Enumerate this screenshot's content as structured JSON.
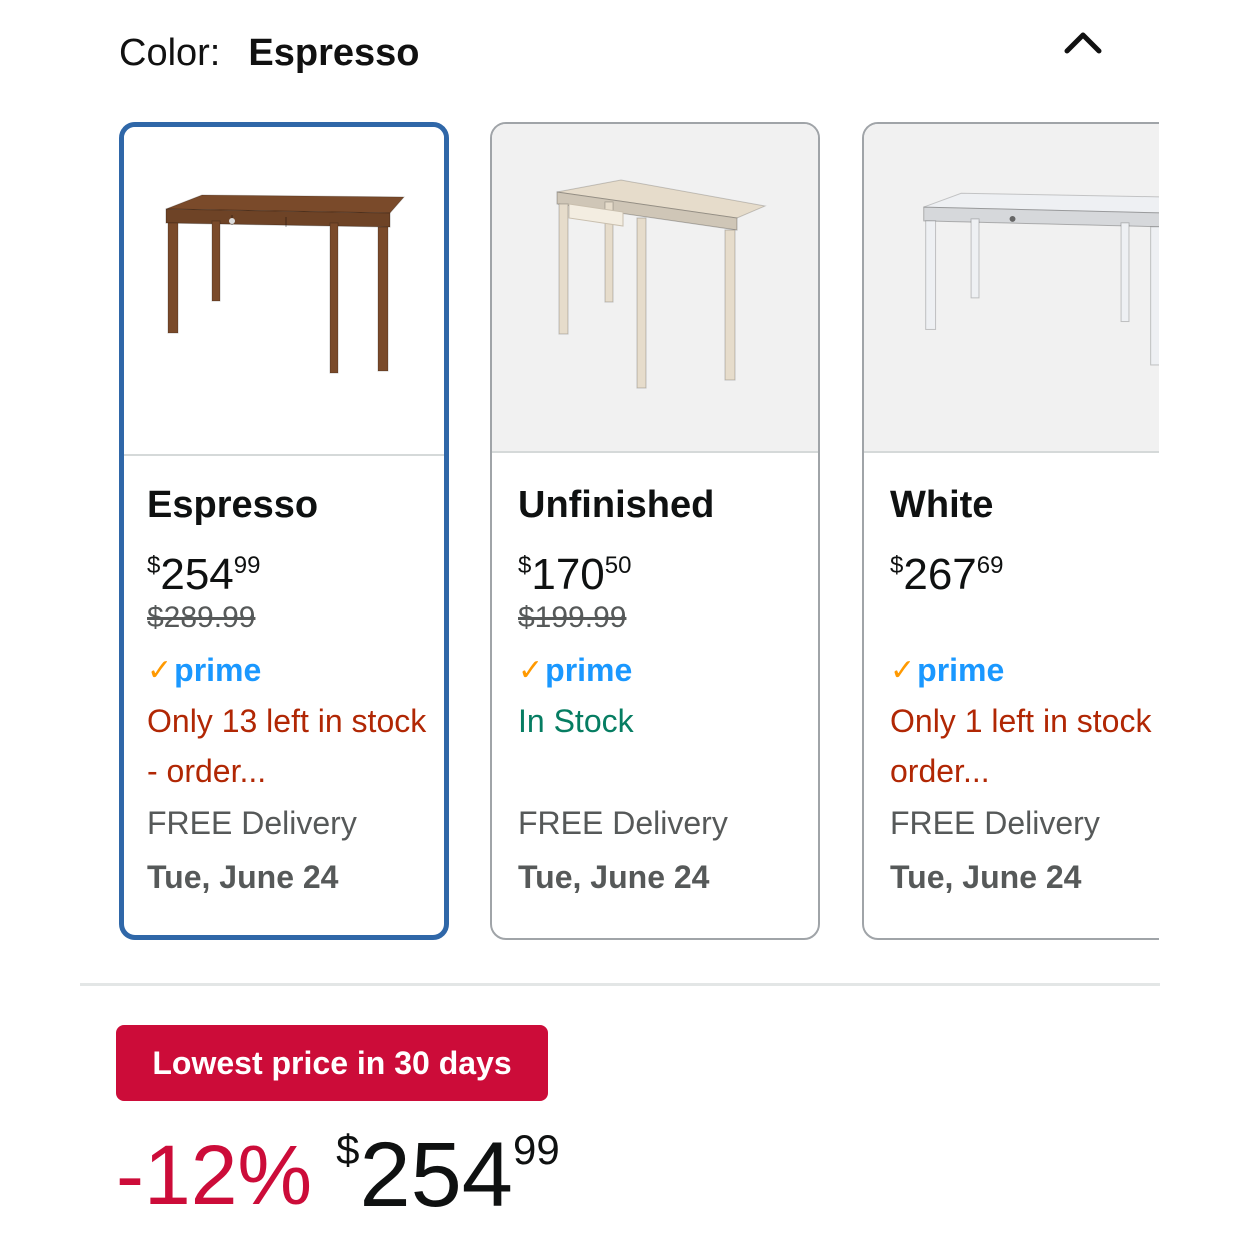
{
  "header": {
    "color_label": "Color:",
    "selected_color": "Espresso",
    "collapse_icon": "chevron-up-icon"
  },
  "variants": [
    {
      "name": "Espresso",
      "price_symbol": "$",
      "price_whole": "254",
      "price_fraction": "99",
      "list_price": "$289.99",
      "prime_label": "prime",
      "stock_text": "Only 13 left in stock - order...",
      "stock_status": "low",
      "delivery_label": "FREE Delivery",
      "delivery_date": "Tue, June 24",
      "selected": true,
      "desk_color": "#7a4a2a"
    },
    {
      "name": "Unfinished",
      "price_symbol": "$",
      "price_whole": "170",
      "price_fraction": "50",
      "list_price": "$199.99",
      "prime_label": "prime",
      "stock_text": "In Stock",
      "stock_status": "in-stock",
      "delivery_label": "FREE Delivery",
      "delivery_date": "Tue, June 24",
      "selected": false,
      "desk_color": "#e6dccb"
    },
    {
      "name": "White",
      "price_symbol": "$",
      "price_whole": "267",
      "price_fraction": "69",
      "list_price": "",
      "prime_label": "prime",
      "stock_text": "Only 1 left in stock - order...",
      "stock_status": "low",
      "delivery_label": "FREE Delivery",
      "delivery_date": "Tue, June 24",
      "selected": false,
      "desk_color": "#eef0f3"
    }
  ],
  "deal": {
    "badge": "Lowest price in 30 days",
    "discount": "-12%",
    "price_symbol": "$",
    "price_whole": "254",
    "price_fraction": "99"
  },
  "colors": {
    "accent_selected": "#2f67a8",
    "deal_red": "#cc0c39",
    "stock_red": "#b12704",
    "stock_green": "#067d62",
    "prime_blue": "#1a98ff",
    "prime_check": "#ff9900"
  }
}
